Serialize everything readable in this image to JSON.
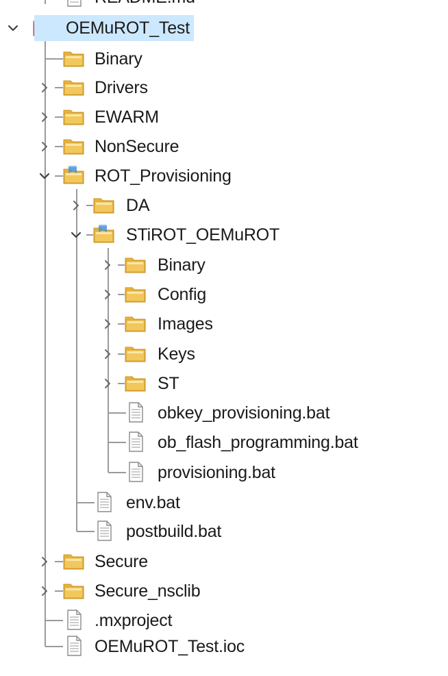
{
  "tree": {
    "items": [
      {
        "label": "README.md",
        "kind": "file",
        "depth": 1,
        "expandable": false
      },
      {
        "label": "OEMuROT_Test",
        "kind": "project",
        "depth": 0,
        "expandable": true,
        "expanded": true,
        "selected": true
      },
      {
        "label": "Binary",
        "kind": "folder",
        "depth": 1,
        "expandable": false
      },
      {
        "label": "Drivers",
        "kind": "folder",
        "depth": 1,
        "expandable": true,
        "expanded": false
      },
      {
        "label": "EWARM",
        "kind": "folder",
        "depth": 1,
        "expandable": true,
        "expanded": false
      },
      {
        "label": "NonSecure",
        "kind": "folder",
        "depth": 1,
        "expandable": true,
        "expanded": false
      },
      {
        "label": "ROT_Provisioning",
        "kind": "folder-open",
        "depth": 1,
        "expandable": true,
        "expanded": true
      },
      {
        "label": "DA",
        "kind": "folder",
        "depth": 2,
        "expandable": true,
        "expanded": false
      },
      {
        "label": "STiROT_OEMuROT",
        "kind": "folder-open",
        "depth": 2,
        "expandable": true,
        "expanded": true
      },
      {
        "label": "Binary",
        "kind": "folder",
        "depth": 3,
        "expandable": true,
        "expanded": false
      },
      {
        "label": "Config",
        "kind": "folder",
        "depth": 3,
        "expandable": true,
        "expanded": false
      },
      {
        "label": "Images",
        "kind": "folder",
        "depth": 3,
        "expandable": true,
        "expanded": false
      },
      {
        "label": "Keys",
        "kind": "folder",
        "depth": 3,
        "expandable": true,
        "expanded": false
      },
      {
        "label": "ST",
        "kind": "folder",
        "depth": 3,
        "expandable": true,
        "expanded": false
      },
      {
        "label": "obkey_provisioning.bat",
        "kind": "file",
        "depth": 3,
        "expandable": false
      },
      {
        "label": "ob_flash_programming.bat",
        "kind": "file",
        "depth": 3,
        "expandable": false
      },
      {
        "label": "provisioning.bat",
        "kind": "file",
        "depth": 3,
        "expandable": false
      },
      {
        "label": "env.bat",
        "kind": "file",
        "depth": 2,
        "expandable": false
      },
      {
        "label": "postbuild.bat",
        "kind": "file",
        "depth": 2,
        "expandable": false
      },
      {
        "label": "Secure",
        "kind": "folder",
        "depth": 1,
        "expandable": true,
        "expanded": false
      },
      {
        "label": "Secure_nsclib",
        "kind": "folder",
        "depth": 1,
        "expandable": true,
        "expanded": false
      },
      {
        "label": ".mxproject",
        "kind": "file",
        "depth": 1,
        "expandable": false
      },
      {
        "label": "OEMuROT_Test.ioc",
        "kind": "file",
        "depth": 1,
        "expandable": false
      }
    ]
  },
  "colors": {
    "selection": "#cce8ff",
    "folder": "#f2c75c",
    "folder_open_flag": "#4a90d9",
    "project": "#d9534f",
    "guide": "#a0a0a0",
    "twisty": "#404040"
  },
  "icons": {
    "chevron_collapsed": "chevron-right-icon",
    "chevron_expanded": "chevron-down-icon",
    "folder": "folder-icon",
    "folder_open": "open-folder-icon",
    "file": "file-icon",
    "project": "project-icon"
  }
}
